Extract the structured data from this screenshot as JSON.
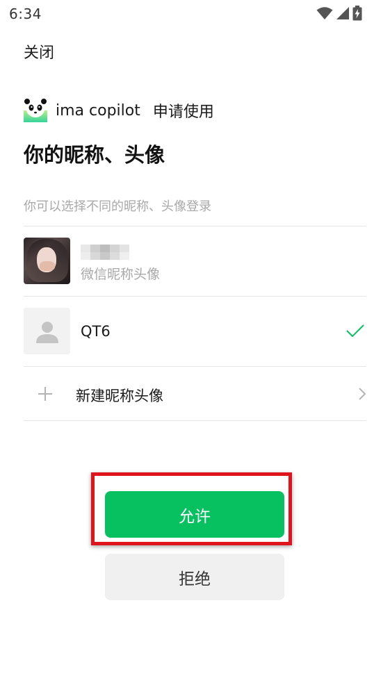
{
  "status_bar": {
    "time": "6:34",
    "icons": [
      "wifi-icon",
      "signal-icon",
      "battery-charging-icon"
    ]
  },
  "close_label": "关闭",
  "app": {
    "name": "ima copilot",
    "request_text": "申请使用"
  },
  "title": "你的昵称、头像",
  "subtitle": "你可以选择不同的昵称、头像登录",
  "options": [
    {
      "type": "wechat-profile",
      "sub_label": "微信昵称头像",
      "selected": false
    },
    {
      "type": "custom-profile",
      "label": "QT6",
      "selected": true
    },
    {
      "type": "create-new",
      "label": "新建昵称头像"
    }
  ],
  "buttons": {
    "allow": "允许",
    "reject": "拒绝"
  },
  "colors": {
    "primary_green": "#07c160",
    "highlight_red": "#e0141c",
    "secondary_button": "#f0f0f0"
  }
}
